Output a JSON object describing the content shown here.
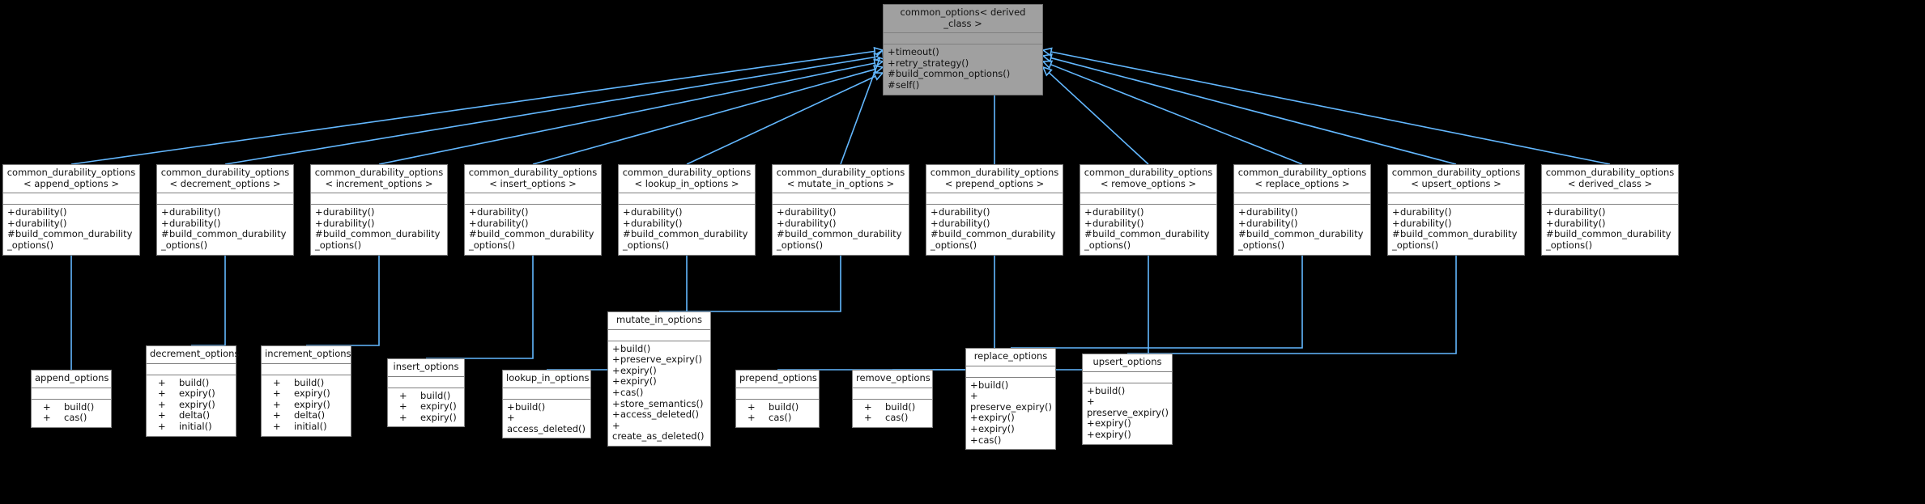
{
  "diagram": {
    "kind": "uml-class-inheritance-diagram",
    "background_color": "#000000",
    "edge_color": "#63b8ff",
    "root_fill_color": "#a0a0a0",
    "node_fill_color": "#ffffff",
    "node_border_color": "#808080",
    "text_color": "#111111"
  },
  "root": {
    "title": "common_options< derived\n_class >",
    "attributes": [],
    "methods": [
      {
        "visibility": "+",
        "name": "timeout()"
      },
      {
        "visibility": "+",
        "name": "retry_strategy()"
      },
      {
        "visibility": "#",
        "name": "build_common_options()"
      },
      {
        "visibility": "#",
        "name": "self()"
      }
    ]
  },
  "middle_row": [
    {
      "title": "common_durability_options\n< append_options >",
      "attributes": [],
      "methods": [
        {
          "visibility": "+",
          "name": "durability()"
        },
        {
          "visibility": "+",
          "name": "durability()"
        },
        {
          "visibility": "#",
          "name": "build_common_durability\n_options()"
        }
      ]
    },
    {
      "title": "common_durability_options\n< decrement_options >",
      "attributes": [],
      "methods": [
        {
          "visibility": "+",
          "name": "durability()"
        },
        {
          "visibility": "+",
          "name": "durability()"
        },
        {
          "visibility": "#",
          "name": "build_common_durability\n_options()"
        }
      ]
    },
    {
      "title": "common_durability_options\n< increment_options >",
      "attributes": [],
      "methods": [
        {
          "visibility": "+",
          "name": "durability()"
        },
        {
          "visibility": "+",
          "name": "durability()"
        },
        {
          "visibility": "#",
          "name": "build_common_durability\n_options()"
        }
      ]
    },
    {
      "title": "common_durability_options\n< insert_options >",
      "attributes": [],
      "methods": [
        {
          "visibility": "+",
          "name": "durability()"
        },
        {
          "visibility": "+",
          "name": "durability()"
        },
        {
          "visibility": "#",
          "name": "build_common_durability\n_options()"
        }
      ]
    },
    {
      "title": "common_durability_options\n< lookup_in_options >",
      "attributes": [],
      "methods": [
        {
          "visibility": "+",
          "name": "durability()"
        },
        {
          "visibility": "+",
          "name": "durability()"
        },
        {
          "visibility": "#",
          "name": "build_common_durability\n_options()"
        }
      ]
    },
    {
      "title": "common_durability_options\n< mutate_in_options >",
      "attributes": [],
      "methods": [
        {
          "visibility": "+",
          "name": "durability()"
        },
        {
          "visibility": "+",
          "name": "durability()"
        },
        {
          "visibility": "#",
          "name": "build_common_durability\n_options()"
        }
      ]
    },
    {
      "title": "common_durability_options\n< prepend_options >",
      "attributes": [],
      "methods": [
        {
          "visibility": "+",
          "name": "durability()"
        },
        {
          "visibility": "+",
          "name": "durability()"
        },
        {
          "visibility": "#",
          "name": "build_common_durability\n_options()"
        }
      ]
    },
    {
      "title": "common_durability_options\n< remove_options >",
      "attributes": [],
      "methods": [
        {
          "visibility": "+",
          "name": "durability()"
        },
        {
          "visibility": "+",
          "name": "durability()"
        },
        {
          "visibility": "#",
          "name": "build_common_durability\n_options()"
        }
      ]
    },
    {
      "title": "common_durability_options\n< replace_options >",
      "attributes": [],
      "methods": [
        {
          "visibility": "+",
          "name": "durability()"
        },
        {
          "visibility": "+",
          "name": "durability()"
        },
        {
          "visibility": "#",
          "name": "build_common_durability\n_options()"
        }
      ]
    },
    {
      "title": "common_durability_options\n< upsert_options >",
      "attributes": [],
      "methods": [
        {
          "visibility": "+",
          "name": "durability()"
        },
        {
          "visibility": "+",
          "name": "durability()"
        },
        {
          "visibility": "#",
          "name": "build_common_durability\n_options()"
        }
      ]
    },
    {
      "title": "common_durability_options\n< derived_class >",
      "attributes": [],
      "methods": [
        {
          "visibility": "+",
          "name": "durability()"
        },
        {
          "visibility": "+",
          "name": "durability()"
        },
        {
          "visibility": "#",
          "name": "build_common_durability\n_options()"
        }
      ]
    }
  ],
  "leaf_row": [
    {
      "title": "append_options",
      "attributes": [],
      "methods": [
        {
          "visibility": "+",
          "name": "build()"
        },
        {
          "visibility": "+",
          "name": "cas()"
        }
      ]
    },
    {
      "title": "decrement_options",
      "attributes": [],
      "methods": [
        {
          "visibility": "+",
          "name": "build()"
        },
        {
          "visibility": "+",
          "name": "expiry()"
        },
        {
          "visibility": "+",
          "name": "expiry()"
        },
        {
          "visibility": "+",
          "name": "delta()"
        },
        {
          "visibility": "+",
          "name": "initial()"
        }
      ]
    },
    {
      "title": "increment_options",
      "attributes": [],
      "methods": [
        {
          "visibility": "+",
          "name": "build()"
        },
        {
          "visibility": "+",
          "name": "expiry()"
        },
        {
          "visibility": "+",
          "name": "expiry()"
        },
        {
          "visibility": "+",
          "name": "delta()"
        },
        {
          "visibility": "+",
          "name": "initial()"
        }
      ]
    },
    {
      "title": "insert_options",
      "attributes": [],
      "methods": [
        {
          "visibility": "+",
          "name": "build()"
        },
        {
          "visibility": "+",
          "name": "expiry()"
        },
        {
          "visibility": "+",
          "name": "expiry()"
        }
      ]
    },
    {
      "title": "lookup_in_options",
      "attributes": [],
      "methods": [
        {
          "visibility": "+",
          "name": "build()"
        },
        {
          "visibility": "+",
          "name": "access_deleted()"
        }
      ]
    },
    {
      "title": "mutate_in_options",
      "attributes": [],
      "methods": [
        {
          "visibility": "+",
          "name": "build()"
        },
        {
          "visibility": "+",
          "name": "preserve_expiry()"
        },
        {
          "visibility": "+",
          "name": "expiry()"
        },
        {
          "visibility": "+",
          "name": "expiry()"
        },
        {
          "visibility": "+",
          "name": "cas()"
        },
        {
          "visibility": "+",
          "name": "store_semantics()"
        },
        {
          "visibility": "+",
          "name": "access_deleted()"
        },
        {
          "visibility": "+",
          "name": "create_as_deleted()"
        }
      ]
    },
    {
      "title": "prepend_options",
      "attributes": [],
      "methods": [
        {
          "visibility": "+",
          "name": "build()"
        },
        {
          "visibility": "+",
          "name": "cas()"
        }
      ]
    },
    {
      "title": "remove_options",
      "attributes": [],
      "methods": [
        {
          "visibility": "+",
          "name": "build()"
        },
        {
          "visibility": "+",
          "name": "cas()"
        }
      ]
    },
    {
      "title": "replace_options",
      "attributes": [],
      "methods": [
        {
          "visibility": "+",
          "name": "build()"
        },
        {
          "visibility": "+",
          "name": "preserve_expiry()"
        },
        {
          "visibility": "+",
          "name": "expiry()"
        },
        {
          "visibility": "+",
          "name": "expiry()"
        },
        {
          "visibility": "+",
          "name": "cas()"
        }
      ]
    },
    {
      "title": "upsert_options",
      "attributes": [],
      "methods": [
        {
          "visibility": "+",
          "name": "build()"
        },
        {
          "visibility": "+",
          "name": "preserve_expiry()"
        },
        {
          "visibility": "+",
          "name": "expiry()"
        },
        {
          "visibility": "+",
          "name": "expiry()"
        }
      ]
    }
  ]
}
